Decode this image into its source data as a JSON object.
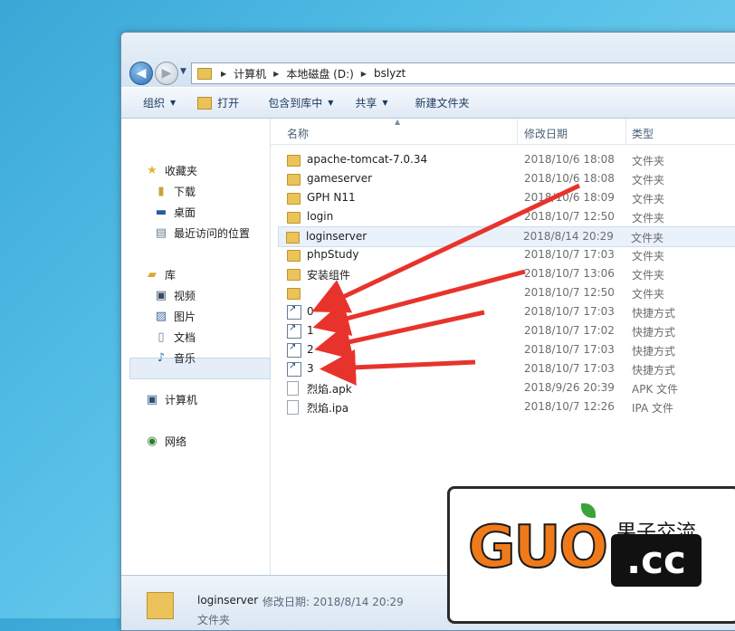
{
  "address": {
    "crumbs": [
      "计算机",
      "本地磁盘 (D:)",
      "bslyzt"
    ]
  },
  "toolbar": {
    "organize": "组织",
    "open": "打开",
    "include": "包含到库中",
    "share": "共享",
    "new_folder": "新建文件夹"
  },
  "nav": {
    "favorites": "收藏夹",
    "downloads": "下载",
    "desktop": "桌面",
    "recent": "最近访问的位置",
    "library": "库",
    "videos": "视频",
    "pictures": "图片",
    "documents": "文档",
    "music": "音乐",
    "computer": "计算机",
    "network": "网络"
  },
  "columns": {
    "name": "名称",
    "date": "修改日期",
    "type": "类型"
  },
  "files": [
    {
      "name": "apache-tomcat-7.0.34",
      "date": "2018/10/6 18:08",
      "type": "文件夹",
      "icon": "folder"
    },
    {
      "name": "gameserver",
      "date": "2018/10/6 18:08",
      "type": "文件夹",
      "icon": "folder"
    },
    {
      "name": "GPH N11",
      "date": "2018/10/6 18:09",
      "type": "文件夹",
      "icon": "folder"
    },
    {
      "name": "login",
      "date": "2018/10/7 12:50",
      "type": "文件夹",
      "icon": "folder"
    },
    {
      "name": "loginserver",
      "date": "2018/8/14 20:29",
      "type": "文件夹",
      "icon": "folder"
    },
    {
      "name": "phpStudy",
      "date": "2018/10/7 17:03",
      "type": "文件夹",
      "icon": "folder"
    },
    {
      "name": "安装组件",
      "date": "2018/10/7 13:06",
      "type": "文件夹",
      "icon": "folder"
    },
    {
      "name": "",
      "date": "2018/10/7 12:50",
      "type": "文件夹",
      "icon": "folder"
    },
    {
      "name": "0",
      "date": "2018/10/7 17:03",
      "type": "快捷方式",
      "icon": "shortcut"
    },
    {
      "name": "1",
      "date": "2018/10/7 17:02",
      "type": "快捷方式",
      "icon": "shortcut"
    },
    {
      "name": "2",
      "date": "2018/10/7 17:03",
      "type": "快捷方式",
      "icon": "shortcut"
    },
    {
      "name": "3",
      "date": "2018/10/7 17:03",
      "type": "快捷方式",
      "icon": "shortcut"
    },
    {
      "name": "烈焰.apk",
      "date": "2018/9/26 20:39",
      "type": "APK 文件",
      "icon": "file"
    },
    {
      "name": "烈焰.ipa",
      "date": "2018/10/7 12:26",
      "type": "IPA 文件",
      "icon": "file"
    }
  ],
  "status": {
    "name": "loginserver",
    "modified": "修改日期: 2018/8/14 20:29",
    "type": "文件夹"
  },
  "logo": {
    "latin": "GUO",
    "domain": ".cc",
    "cn": "果子交流"
  },
  "colors": {
    "arrow": "#e8332c",
    "logo_orange": "#f07a1a"
  }
}
